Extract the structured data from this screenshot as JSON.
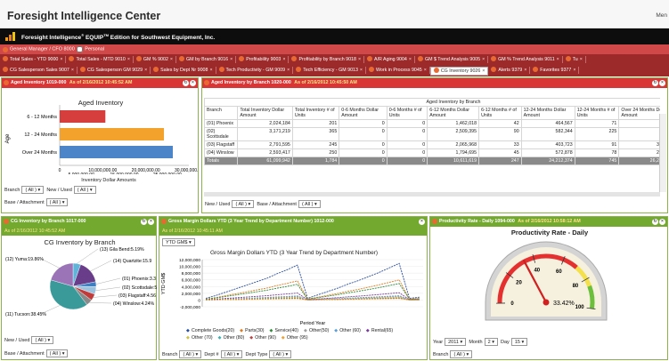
{
  "app": {
    "title": "Foresight Intelligence Center",
    "menu": "Men",
    "edition_a": "Foresight Intelligence",
    "sup1": "®",
    "edition_b": " EQUIP",
    "sup2": "TM",
    "edition_c": " Edition for Southwest Equipment, Inc."
  },
  "colors": {
    "red": "#d93535",
    "green": "#73a92f",
    "dark_red": "#9d2a2a"
  },
  "bar1": {
    "role": "General Manager / CFO 8000",
    "personal": "Personal"
  },
  "tabs_row1": [
    "Total Sales - YTD 9000",
    "Total Sales - MTD 9010",
    "GM % 9002",
    "GM by Branch 9016",
    "Profitability 9003",
    "Profitability by Branch 9018",
    "A/R Aging 9004",
    "GM $ Trend Analysis 9005",
    "GM % Trend Analysis 9011",
    "Tu"
  ],
  "tabs_row2": [
    "CG Salesperson Sales 9007",
    "CG Salesperson GM 9029",
    "Sales by Dept Nr 9008",
    "Tech Productivity - GM 9009",
    "Tech Efficiency - GM 9013",
    "Work in Process 9045",
    "CG Inventory 9026",
    "Alerts 9379",
    "Favorites 9377"
  ],
  "tabs_row2_active": 6,
  "p1": {
    "title": "Aged Inventory 1019-000",
    "date": "As of 2/16/2012 10:45:52 AM",
    "chart_title": "Aged Inventory",
    "ylabel": "Age",
    "xlabel": "Inventory Dollar Amounts",
    "branch_label": "Branch",
    "branch_value": "( All )",
    "newused_label": "New / Used",
    "newused_value": "( All )",
    "base_label": "Base / Attachment",
    "base_value": "( All )"
  },
  "p2": {
    "title": "Aged Inventory by Branch 1020-000",
    "date": "As of 2/16/2012 10:45:50 AM",
    "caption": "Aged Inventory by Branch",
    "columns": [
      "Branch",
      "Total Inventory Dollar Amount",
      "Total Inventory # of Units",
      "0-6 Months Dollar Amount",
      "0-6 Months # of Units",
      "6-12 Months Dollar Amount",
      "6-12 Months # of Units",
      "12-24 Months Dollar Amount",
      "12-24 Months # of Units",
      "Over 24 Months Dollar Amount",
      "Ove Mon Uni"
    ],
    "rows": [
      [
        "(01) Phoenix",
        "2,024,184",
        "201",
        "0",
        "0",
        "1,462,018",
        "42",
        "464,567",
        "71",
        "97,599",
        ""
      ],
      [
        "(02) Scottsdale",
        "3,171,219",
        "365",
        "0",
        "0",
        "2,509,395",
        "90",
        "582,344",
        "225",
        "79,481",
        ""
      ],
      [
        "(03) Flagstaff",
        "2,791,595",
        "245",
        "0",
        "0",
        "2,065,968",
        "33",
        "403,723",
        "91",
        "321,904",
        ""
      ],
      [
        "(04) Winslow",
        "2,593,417",
        "250",
        "0",
        "0",
        "1,794,695",
        "45",
        "572,878",
        "78",
        "225,844",
        ""
      ]
    ],
    "totals": [
      "Totals",
      "61,099,942",
      "1,784",
      "0",
      "0",
      "10,611,619",
      "247",
      "24,212,374",
      "745",
      "26,275,949",
      ""
    ],
    "newused_label": "New / Used",
    "newused_value": "( All )",
    "base_label": "Base / Attachment",
    "base_value": "( All )"
  },
  "p3": {
    "title": "CG Inventory by Branch 1017-000",
    "date": "As of 2/16/2012 10:45:52 AM",
    "chart_title": "CG Inventory by Branch",
    "newused_label": "New / Used",
    "newused_value": "( All )",
    "base_label": "Base / Attachment",
    "base_value": "( All )"
  },
  "p4": {
    "title": "Gross Margin Dollars YTD (3 Year Trend by Department Number) 1012-000",
    "date": "As of 2/16/2012 10:45:11 AM",
    "selector": "YTD GM$",
    "chart_title": "Gross Margin Dollars YTD (3 Year Trend by Department Number)",
    "ylabel": "YTD GM$",
    "xlabel": "Period Year",
    "branch_label": "Branch",
    "branch_value": "( All )",
    "dept_label": "Dept #",
    "dept_value": "( All )",
    "depttype_label": "Dept Type",
    "depttype_value": "( All )"
  },
  "p5": {
    "title": "Productivity Rate - Daily 1094-000",
    "date": "As of 2/16/2012 10:58:12 AM",
    "chart_title": "Productivity Rate - Daily",
    "value_text": "33.42%",
    "year_label": "Year",
    "year_value": "2011",
    "month_label": "Month",
    "month_value": "2",
    "day_label": "Day",
    "day_value": "15",
    "branch_label": "Branch",
    "branch_value": "( All )"
  },
  "chart_data": [
    {
      "type": "bar",
      "orientation": "horizontal",
      "title": "Aged Inventory",
      "categories": [
        "6 - 12 Months",
        "12 - 24 Months",
        "Over 24 Months"
      ],
      "values": [
        10611619,
        24212374,
        26275949
      ],
      "colors": [
        "#d63d3d",
        "#f3a22b",
        "#4d86c8"
      ],
      "xlim": [
        0,
        30000000
      ],
      "ticks_top": [
        "0",
        "10,000,000.00",
        "20,000,000.00",
        "30,000,000.00"
      ],
      "ticks_bottom": [
        "5,000,000.00",
        "15,000,000.00",
        "25,000,000.00"
      ],
      "xlabel": "Inventory Dollar Amounts",
      "ylabel": "Age"
    },
    {
      "type": "pie",
      "title": "CG Inventory by Branch",
      "slices": [
        {
          "label": "(13) Gila Bend:5.19%",
          "value": 5.19,
          "color": "#5fb4d9"
        },
        {
          "label": "(14) Quartzite:15.9",
          "value": 15.9,
          "color": "#6a3d8a"
        },
        {
          "label": "(01) Phoenix:3.3",
          "value": 3.3,
          "color": "#3e7fc1"
        },
        {
          "label": "(02) Scottsdale:5",
          "value": 5.2,
          "color": "#9bc3e0"
        },
        {
          "label": "(03) Flagstaff:4.56",
          "value": 4.56,
          "color": "#c23b3b"
        },
        {
          "label": "(04) Winslow:4.24%",
          "value": 4.24,
          "color": "#8a8a8a"
        },
        {
          "label": "(11) Tucson:38.45%",
          "value": 38.45,
          "color": "#3a9a9a"
        },
        {
          "label": "(12) Yuma:19.86%",
          "value": 19.86,
          "color": "#9b74b8"
        }
      ]
    },
    {
      "type": "line",
      "title": "Gross Margin Dollars YTD (3 Year Trend by Department Number)",
      "ylabel": "YTD GM$",
      "xlabel": "Period Year",
      "ylim": [
        -2000000,
        12000000
      ],
      "yticks": [
        "12,000,000",
        "10,000,000",
        "8,000,000",
        "6,000,000",
        "4,000,000",
        "2,000,000",
        "0",
        "-2,000,000"
      ],
      "series": [
        {
          "name": "Complete Goods(20)",
          "color": "#2b4fa0"
        },
        {
          "name": "Parts(30)",
          "color": "#e07a1f"
        },
        {
          "name": "Service(40)",
          "color": "#2e8b3a"
        },
        {
          "name": "Other(50)",
          "color": "#a0a0a0"
        },
        {
          "name": "Other (60)",
          "color": "#5aa0d8"
        },
        {
          "name": "Rental(65)",
          "color": "#7a3e9a"
        },
        {
          "name": "Other (70)",
          "color": "#d0c040"
        },
        {
          "name": "Other (80)",
          "color": "#3ab0b0"
        },
        {
          "name": "Other (90)",
          "color": "#c04040"
        },
        {
          "name": "Other (95)",
          "color": "#f0a030"
        }
      ],
      "trend": [
        [
          0.3,
          0.8,
          1.4,
          2.0,
          2.6,
          3.2,
          3.8,
          4.6,
          5.3,
          6.1,
          0.3,
          0.9,
          1.5,
          2.1,
          2.8,
          3.4,
          4.1,
          4.8,
          5.6,
          6.4,
          0.3,
          0.5
        ]
      ]
    },
    {
      "type": "gauge",
      "title": "Productivity Rate - Daily",
      "min": 0,
      "max": 100,
      "ticks": [
        0,
        20,
        40,
        60,
        80,
        100
      ],
      "value": 33.42,
      "value_label": "33.42%"
    }
  ]
}
